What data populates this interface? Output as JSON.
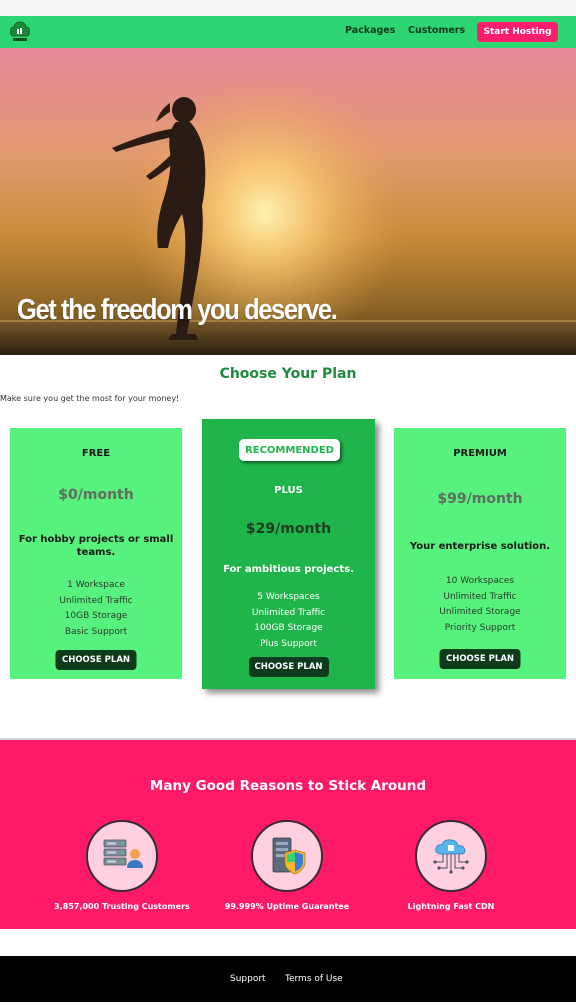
{
  "header": {
    "nav": [
      {
        "label": "Packages"
      },
      {
        "label": "Customers"
      }
    ],
    "cta_label": "Start Hosting",
    "brand_color": "#2ed573",
    "cta_color": "#ff1e6e"
  },
  "hero": {
    "title": "Get the freedom you deserve."
  },
  "plans": {
    "title": "Choose Your Plan",
    "subtitle": "Make sure you get the most for your money!",
    "items": [
      {
        "name": "FREE",
        "price": "$0/month",
        "description": "For hobby projects or small teams.",
        "features": [
          "1 Workspace",
          "Unlimited Traffic",
          "10GB Storage",
          "Basic Support"
        ],
        "button": "CHOOSE PLAN"
      },
      {
        "badge": "RECOMMENDED",
        "name": "PLUS",
        "price": "$29/month",
        "description": "For ambitious projects.",
        "features": [
          "5 Workspaces",
          "Unlimited Traffic",
          "100GB Storage",
          "Plus Support"
        ],
        "button": "CHOOSE PLAN"
      },
      {
        "name": "PREMIUM",
        "price": "$99/month",
        "description": "Your enterprise solution.",
        "features": [
          "10 Workspaces",
          "Unlimited Traffic",
          "Unlimited Storage",
          "Priority Support"
        ],
        "button": "CHOOSE PLAN"
      }
    ]
  },
  "reasons": {
    "title": "Many Good Reasons to Stick Around",
    "items": [
      {
        "label": "3,857,000 Trusting Customers",
        "icon": "server-customer-icon"
      },
      {
        "label": "99.999% Uptime Guarantee",
        "icon": "server-shield-icon"
      },
      {
        "label": "Lightning Fast CDN",
        "icon": "cloud-network-icon"
      }
    ],
    "bg_color": "#ff1a66"
  },
  "footer": {
    "links": [
      {
        "label": "Support"
      },
      {
        "label": "Terms of Use"
      }
    ]
  }
}
